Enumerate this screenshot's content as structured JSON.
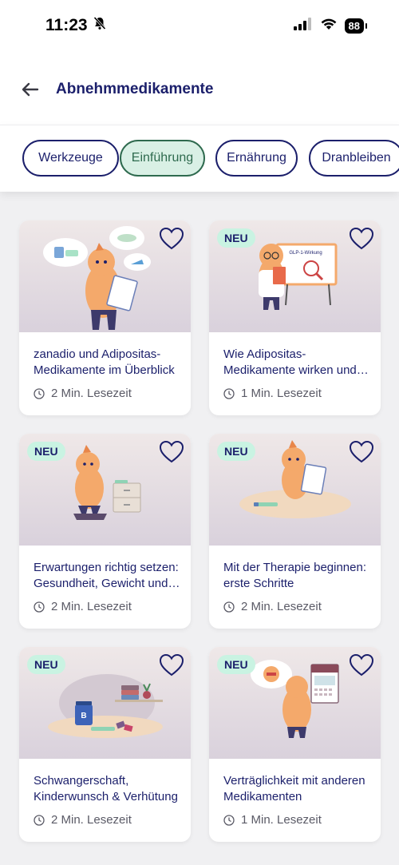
{
  "status": {
    "time": "11:23",
    "battery": "88"
  },
  "header": {
    "title": "Abnehmmedikamente"
  },
  "tabs": [
    {
      "label": "Werkzeuge"
    },
    {
      "label": "Einführung"
    },
    {
      "label": "Ernährung"
    },
    {
      "label": "Dranbleiben"
    }
  ],
  "cards": [
    {
      "badge": "",
      "title": "zanadio und Adipositas-Medikamente im Überblick",
      "meta": "2 Min. Lesezeit"
    },
    {
      "badge": "NEU",
      "title": "Wie Adipositas-Medikamente wirken und was sie bewirken",
      "meta": "1 Min. Lesezeit"
    },
    {
      "badge": "NEU",
      "title": "Erwartungen richtig setzen: Gesundheit, Gewicht und mehr",
      "meta": "2 Min. Lesezeit"
    },
    {
      "badge": "NEU",
      "title": "Mit der Therapie beginnen: erste Schritte",
      "meta": "2 Min. Lesezeit"
    },
    {
      "badge": "NEU",
      "title": "Schwangerschaft, Kinderwunsch & Verhütung",
      "meta": "2 Min. Lesezeit"
    },
    {
      "badge": "NEU",
      "title": "Verträglichkeit mit anderen Medikamenten",
      "meta": "1 Min. Lesezeit"
    }
  ],
  "illustrations": {
    "card_2_board": "GLP-1-Wirkung",
    "card_5_jar": "B"
  },
  "colors": {
    "primary": "#1b1f6b",
    "active_tab_bg": "#d9f0e5",
    "active_tab_text": "#2e6a4e",
    "badge_bg": "#c9f3e2",
    "background": "#f0f0f2"
  }
}
